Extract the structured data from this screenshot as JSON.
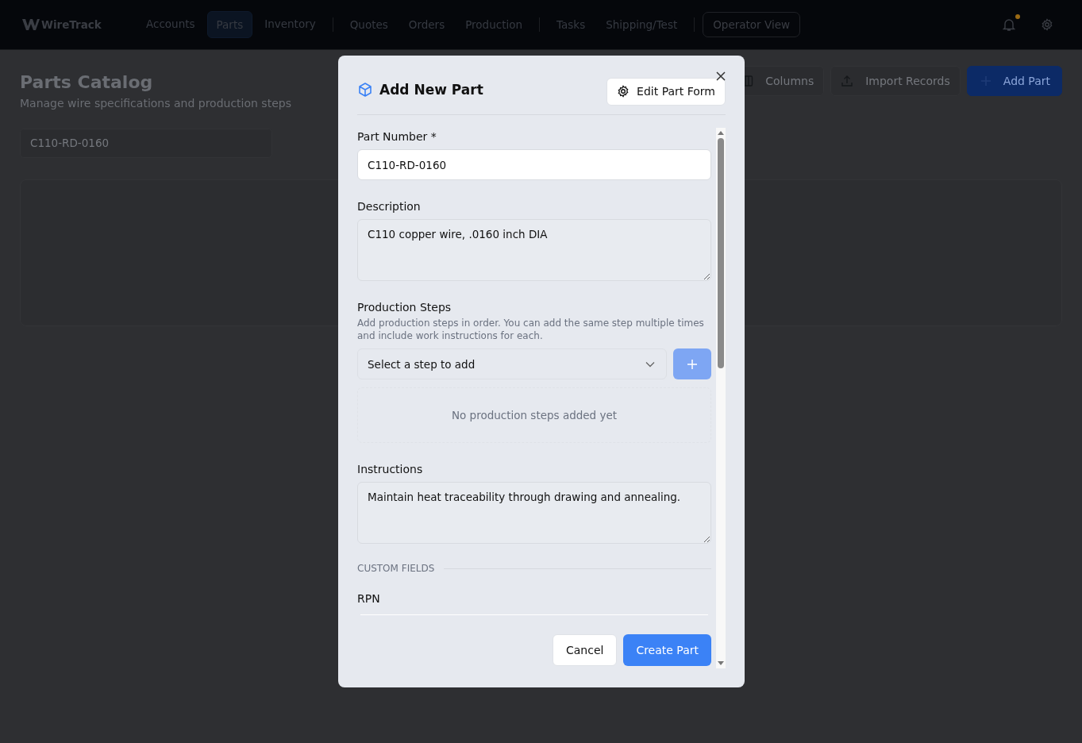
{
  "app": {
    "logo": "WireTrack",
    "notifications": true
  },
  "nav": {
    "groups": [
      [
        {
          "label": "Accounts",
          "selected": false
        },
        {
          "label": "Parts",
          "selected": true
        },
        {
          "label": "Inventory",
          "selected": false
        }
      ],
      [
        {
          "label": "Quotes",
          "selected": false
        },
        {
          "label": "Orders",
          "selected": false
        },
        {
          "label": "Production",
          "selected": false
        }
      ],
      [
        {
          "label": "Tasks",
          "selected": false
        },
        {
          "label": "Shipping/Test",
          "selected": false
        }
      ]
    ],
    "operator_button": "Operator View"
  },
  "page": {
    "title": "Parts Catalog",
    "subtitle": "Manage wire specifications and production steps",
    "search": {
      "value": "C110-RD-0160"
    },
    "toolbar": [
      {
        "kind": "columns",
        "label": "Columns"
      },
      {
        "kind": "import",
        "label": "Import Records"
      },
      {
        "kind": "add",
        "label": "Add Part"
      }
    ]
  },
  "dialog": {
    "title": "Add New Part",
    "edit_button": "Edit Part Form",
    "fields": [
      {
        "kind": "input",
        "label": "Part Number *",
        "value": "C110-RD-0160"
      },
      {
        "kind": "textarea",
        "label": "Description",
        "value": "C110 copper wire, .0160 inch DIA"
      },
      {
        "kind": "steps",
        "label": "Production Steps",
        "help": "Add production steps in order. You can add the same step multiple times and include work instructions for each.",
        "placeholder": "Select a step to add",
        "add_disabled": true,
        "empty": "No production steps added yet"
      },
      {
        "kind": "textarea",
        "label": "Instructions",
        "value": "Maintain heat traceability through drawing and annealing."
      },
      {
        "kind": "section",
        "label": "CUSTOM FIELDS"
      },
      {
        "kind": "cut",
        "label": "RPN"
      }
    ],
    "buttons": [
      {
        "kind": "secondary",
        "label": "Cancel"
      },
      {
        "kind": "primary",
        "label": "Create Part"
      }
    ]
  }
}
